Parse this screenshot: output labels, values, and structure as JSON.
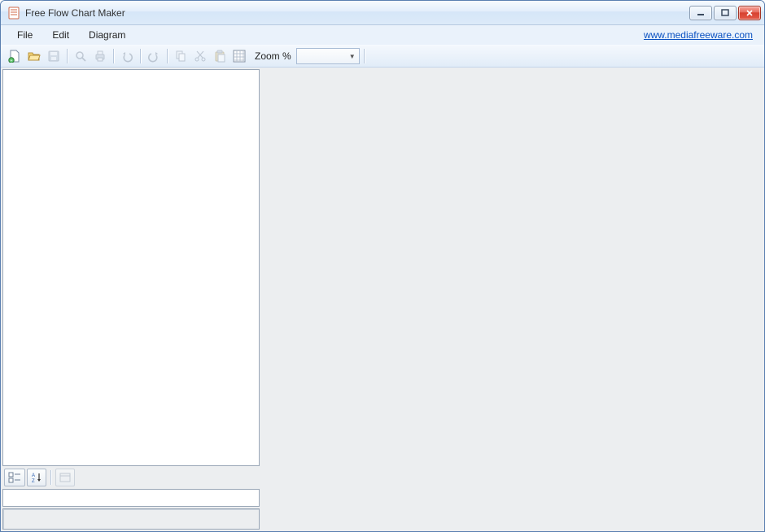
{
  "window": {
    "title": "Free Flow Chart Maker"
  },
  "menubar": {
    "items": [
      "File",
      "Edit",
      "Diagram"
    ],
    "link": "www.mediafreeware.com"
  },
  "toolbar": {
    "zoom_label": "Zoom %",
    "zoom_value": "",
    "icons": {
      "new": "new",
      "open": "open",
      "save": "save",
      "find": "find",
      "print": "print",
      "undo": "undo",
      "redo": "redo",
      "copy": "copy",
      "cut": "cut",
      "paste": "paste",
      "grid": "grid"
    }
  },
  "left_pane": {
    "property_view": {
      "category_btn": "categorized",
      "sort_btn": "alphabetical",
      "pages_btn": "property-pages"
    },
    "name_field": "",
    "desc_field": ""
  }
}
